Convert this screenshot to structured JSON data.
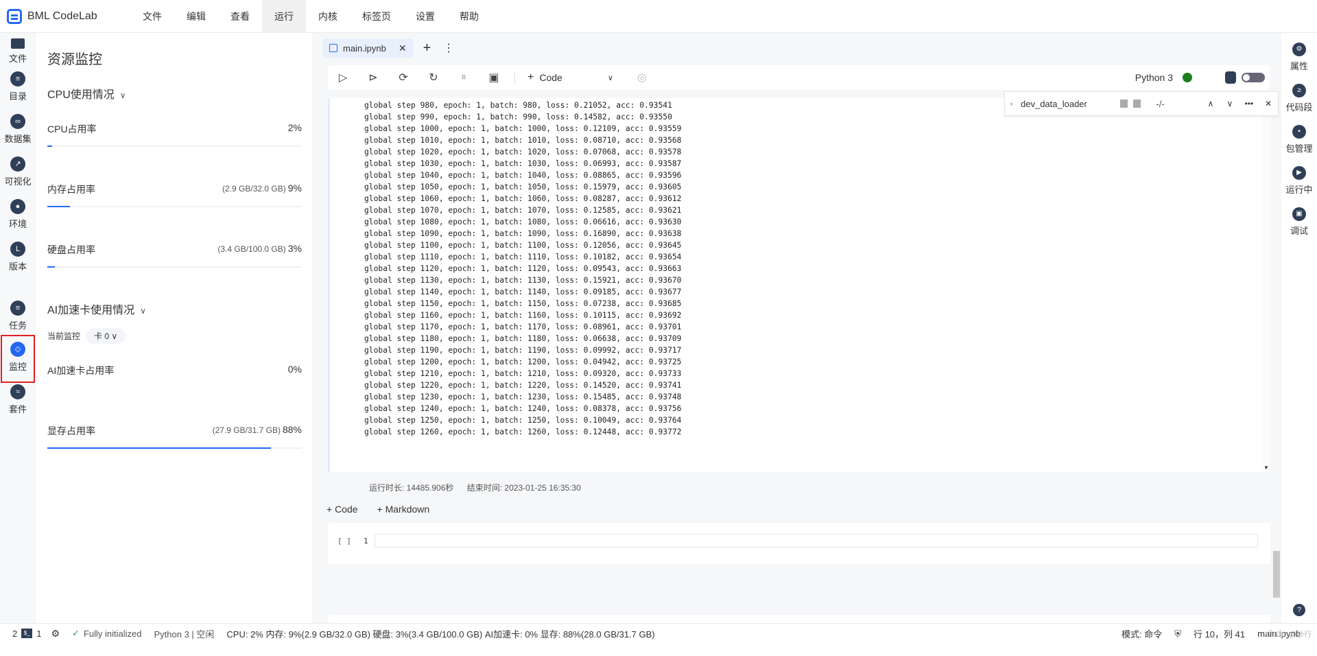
{
  "app": {
    "name": "BML CodeLab"
  },
  "menu": [
    "文件",
    "编辑",
    "查看",
    "运行",
    "内核",
    "标签页",
    "设置",
    "帮助"
  ],
  "menu_active": "运行",
  "left_rail": [
    {
      "label": "文件",
      "icon": "folder-icon"
    },
    {
      "label": "目录",
      "icon": "toc-icon"
    },
    {
      "label": "数据集",
      "icon": "dataset-icon"
    },
    {
      "label": "可视化",
      "icon": "chart-icon"
    },
    {
      "label": "环境",
      "icon": "environment-icon"
    },
    {
      "label": "版本",
      "icon": "version-icon"
    },
    {
      "label": "任务",
      "icon": "task-icon"
    },
    {
      "label": "监控",
      "icon": "monitor-icon"
    },
    {
      "label": "套件",
      "icon": "suite-icon"
    }
  ],
  "left_rail_selected": "监控",
  "monitor": {
    "title": "资源监控",
    "cpu_section": "CPU使用情况",
    "cpu": {
      "label": "CPU占用率",
      "detail": "",
      "value": "2%",
      "fraction": 0.02
    },
    "mem": {
      "label": "内存占用率",
      "detail": "(2.9 GB/32.0 GB)",
      "value": "9%",
      "fraction": 0.09
    },
    "disk": {
      "label": "硬盘占用率",
      "detail": "(3.4 GB/100.0 GB)",
      "value": "3%",
      "fraction": 0.03
    },
    "ai_section": "AI加速卡使用情况",
    "current_label": "当前监控",
    "card": "卡 0",
    "ai": {
      "label": "AI加速卡占用率",
      "detail": "",
      "value": "0%",
      "fraction": 0.0
    },
    "vram": {
      "label": "显存占用率",
      "detail": "(27.9 GB/31.7 GB)",
      "value": "88%",
      "fraction": 0.88
    }
  },
  "tab": {
    "filename": "main.ipynb",
    "close": "✕",
    "add": "+",
    "more": "⋮"
  },
  "toolbar": {
    "cell_type": "Code",
    "kernel": "Python 3",
    "kernel_color": "#1a7f1a"
  },
  "find": {
    "query": "dev_data_loader",
    "count": "-/-"
  },
  "output_lines": [
    "global step 980, epoch: 1, batch: 980, loss: 0.21052, acc: 0.93541",
    "global step 990, epoch: 1, batch: 990, loss: 0.14582, acc: 0.93550",
    "global step 1000, epoch: 1, batch: 1000, loss: 0.12109, acc: 0.93559",
    "global step 1010, epoch: 1, batch: 1010, loss: 0.08710, acc: 0.93568",
    "global step 1020, epoch: 1, batch: 1020, loss: 0.07068, acc: 0.93578",
    "global step 1030, epoch: 1, batch: 1030, loss: 0.06993, acc: 0.93587",
    "global step 1040, epoch: 1, batch: 1040, loss: 0.08865, acc: 0.93596",
    "global step 1050, epoch: 1, batch: 1050, loss: 0.15979, acc: 0.93605",
    "global step 1060, epoch: 1, batch: 1060, loss: 0.08287, acc: 0.93612",
    "global step 1070, epoch: 1, batch: 1070, loss: 0.12585, acc: 0.93621",
    "global step 1080, epoch: 1, batch: 1080, loss: 0.06616, acc: 0.93630",
    "global step 1090, epoch: 1, batch: 1090, loss: 0.16890, acc: 0.93638",
    "global step 1100, epoch: 1, batch: 1100, loss: 0.12056, acc: 0.93645",
    "global step 1110, epoch: 1, batch: 1110, loss: 0.10182, acc: 0.93654",
    "global step 1120, epoch: 1, batch: 1120, loss: 0.09543, acc: 0.93663",
    "global step 1130, epoch: 1, batch: 1130, loss: 0.15921, acc: 0.93670",
    "global step 1140, epoch: 1, batch: 1140, loss: 0.09185, acc: 0.93677",
    "global step 1150, epoch: 1, batch: 1150, loss: 0.07238, acc: 0.93685",
    "global step 1160, epoch: 1, batch: 1160, loss: 0.10115, acc: 0.93692",
    "global step 1170, epoch: 1, batch: 1170, loss: 0.08961, acc: 0.93701",
    "global step 1180, epoch: 1, batch: 1180, loss: 0.06638, acc: 0.93709",
    "global step 1190, epoch: 1, batch: 1190, loss: 0.09992, acc: 0.93717",
    "global step 1200, epoch: 1, batch: 1200, loss: 0.04942, acc: 0.93725",
    "global step 1210, epoch: 1, batch: 1210, loss: 0.09320, acc: 0.93733",
    "global step 1220, epoch: 1, batch: 1220, loss: 0.14520, acc: 0.93741",
    "global step 1230, epoch: 1, batch: 1230, loss: 0.15485, acc: 0.93748",
    "global step 1240, epoch: 1, batch: 1240, loss: 0.08378, acc: 0.93756",
    "global step 1250, epoch: 1, batch: 1250, loss: 0.10049, acc: 0.93764",
    "global step 1260, epoch: 1, batch: 1260, loss: 0.12448, acc: 0.93772"
  ],
  "exec": {
    "duration": "运行时长:  14485.906秒",
    "end": "结束时间:  2023-01-25 16:35:30"
  },
  "add_buttons": {
    "code": "+ Code",
    "markdown": "+ Markdown"
  },
  "cells": [
    {
      "prompt": "[ ]",
      "line": "1"
    },
    {
      "prompt": "[ ]",
      "line": "1"
    }
  ],
  "right_rail": [
    {
      "label": "属性",
      "icon": "properties-icon"
    },
    {
      "label": "代码段",
      "icon": "snippet-icon"
    },
    {
      "label": "包管理",
      "icon": "package-icon"
    },
    {
      "label": "运行中",
      "icon": "running-icon"
    },
    {
      "label": "调试",
      "icon": "debug-icon"
    }
  ],
  "status": {
    "num1": "2",
    "num2": "1",
    "init": "Fully initialized",
    "kernel_state": "Python 3 | 空闲",
    "resources": "CPU:  2% 内存:  9%(2.9 GB/32.0 GB) 硬盘:  3%(3.4 GB/100.0 GB)  AI加速卡:  0%  显存:  88%(28.0 GB/31.7 GB)",
    "mode": "模式: 命令",
    "position": "行 10，列 41",
    "file": "main.ipynb"
  },
  "watermark": "CSDN @孙行"
}
